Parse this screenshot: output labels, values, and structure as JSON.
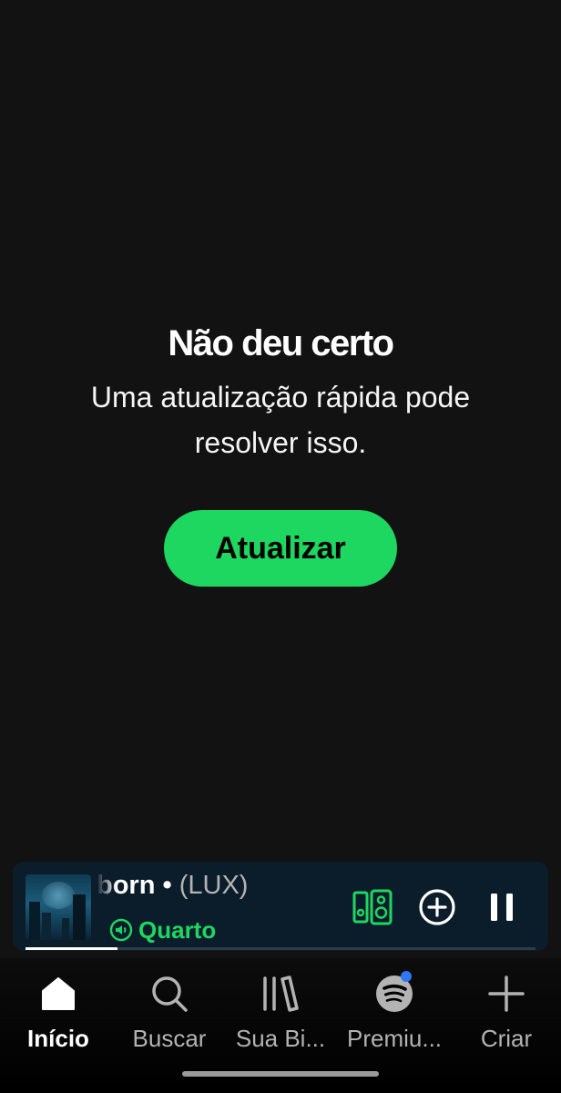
{
  "error": {
    "title": "Não deu certo",
    "message": "Uma atualização rápida pode resolver isso.",
    "button_label": "Atualizar"
  },
  "mini_player": {
    "track_name": "born",
    "separator": " • ",
    "artist": "(LUX)",
    "device_label": "Quarto",
    "progress": 0.18,
    "controls": [
      "connect-device-icon",
      "add-icon",
      "pause-icon"
    ]
  },
  "nav": {
    "items": [
      {
        "label": "Início",
        "icon": "home-icon",
        "active": true
      },
      {
        "label": "Buscar",
        "icon": "search-icon",
        "active": false
      },
      {
        "label": "Sua Bi...",
        "icon": "library-icon",
        "active": false
      },
      {
        "label": "Premiu...",
        "icon": "spotify-icon",
        "active": false
      },
      {
        "label": "Criar",
        "icon": "plus-icon",
        "active": false
      }
    ]
  },
  "colors": {
    "background": "#121212",
    "accent": "#1ed760",
    "player_bg": "#0b1c2b",
    "notification_dot": "#2e77f6"
  }
}
